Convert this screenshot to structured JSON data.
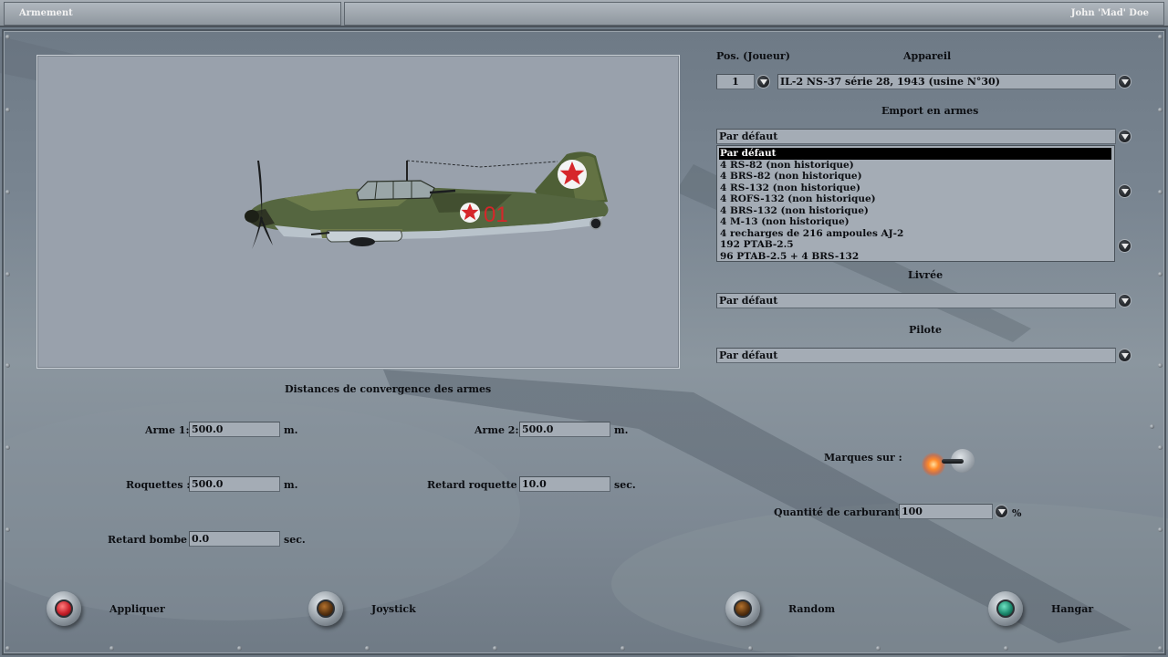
{
  "header": {
    "title": "Armement",
    "user": "John 'Mad' Doe"
  },
  "aircraft_panel": {
    "pos_label": "Pos. (Joueur)",
    "appareil_label": "Appareil",
    "pos_value": "1",
    "appareil_value": "IL-2 NS-37 série 28, 1943 (usine N°30)",
    "emport_label": "Emport en armes",
    "emport_value": "Par défaut",
    "emport_options": [
      "Par défaut",
      "4 RS-82 (non historique)",
      "4 BRS-82 (non historique)",
      "4 RS-132 (non historique)",
      "4 ROFS-132 (non historique)",
      "4 BRS-132 (non historique)",
      "4 M-13 (non historique)",
      "4 recharges de 216 ampoules AJ-2",
      "192 PTAB-2.5",
      "96 PTAB-2.5 + 4 BRS-132"
    ],
    "livree_label": "Livrée",
    "livree_value": "Par défaut",
    "pilote_label": "Pilote",
    "pilote_value": "Par défaut"
  },
  "convergence": {
    "title": "Distances de convergence des armes",
    "arme1_label": "Arme 1:",
    "arme1_value": "500.0",
    "arme1_unit": "m.",
    "arme2_label": "Arme 2:",
    "arme2_value": "500.0",
    "arme2_unit": "m.",
    "roquettes_label": "Roquettes :",
    "roquettes_value": "500.0",
    "roquettes_unit": "m.",
    "retard_roquette_label": "Retard roquette :",
    "retard_roquette_value": "10.0",
    "retard_roquette_unit": "sec.",
    "retard_bombe_label": "Retard bombe :",
    "retard_bombe_value": "0.0",
    "retard_bombe_unit": "sec."
  },
  "options": {
    "marques_label": "Marques sur :",
    "carburant_label": "Quantité de carburant :",
    "carburant_value": "100",
    "carburant_unit": "%"
  },
  "buttons": {
    "appliquer": "Appliquer",
    "joystick": "Joystick",
    "random": "Random",
    "hangar": "Hangar"
  },
  "aircraft_markings": {
    "tail_number": "01"
  },
  "colors": {
    "appliquer_lamp": "#c8202a",
    "joystick_lamp": "#5a3410",
    "random_lamp": "#5a3410",
    "hangar_lamp": "#1c8a6e",
    "marking_red": "#d6262a"
  }
}
